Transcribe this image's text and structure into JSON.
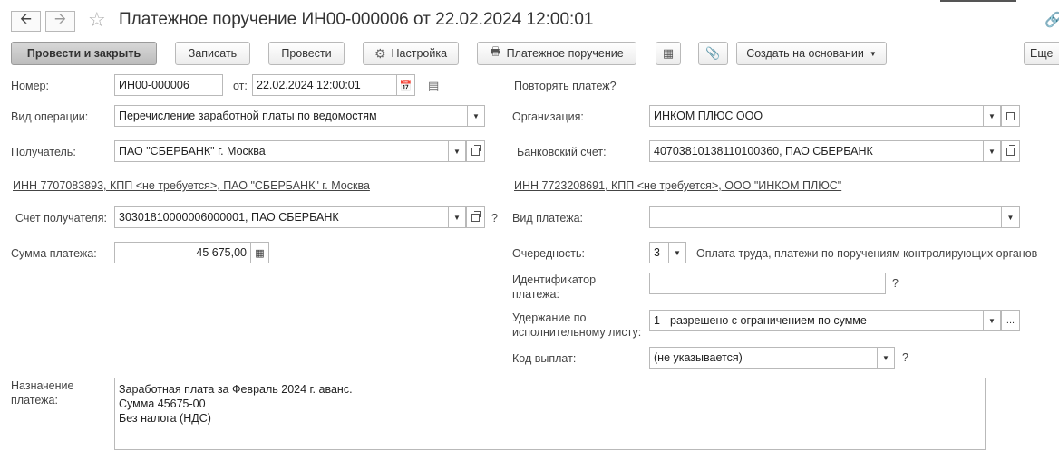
{
  "window": {
    "title": "Платежное поручение ИН00-000006 от 22.02.2024 12:00:01",
    "back_icon": "arrow-left-icon",
    "forward_icon": "arrow-right-icon",
    "favorite_icon": "star-icon"
  },
  "toolbar": {
    "post_and_close": "Провести и закрыть",
    "save": "Записать",
    "post": "Провести",
    "settings": "Настройка",
    "payment_order_print": "Платежное поручение",
    "create_based_on": "Создать на основании",
    "more": "Еще"
  },
  "form": {
    "number_label": "Номер:",
    "number_value": "ИН00-000006",
    "date_label": "от:",
    "date_value": "22.02.2024 12:00:01",
    "repeat_payment_link": "Повторять платеж?",
    "operation_type_label": "Вид операции:",
    "operation_type_value": "Перечисление заработной платы по ведомостям",
    "organization_label": "Организация:",
    "organization_value": "ИНКОМ ПЛЮС ООО",
    "recipient_label": "Получатель:",
    "recipient_value": "ПАО \"СБЕРБАНК\" г. Москва",
    "bank_account_label": "Банковский счет:",
    "bank_account_value": "40703810138110100360, ПАО СБЕРБАНК",
    "recipient_inn_link": "ИНН 7707083893, КПП <не требуется>, ПАО \"СБЕРБАНК\" г. Москва",
    "org_inn_link": "ИНН 7723208691, КПП <не требуется>, ООО \"ИНКОМ ПЛЮС\"",
    "recipient_account_label": "Счет получателя:",
    "recipient_account_value": "30301810000006000001, ПАО СБЕРБАНК",
    "payment_type_label": "Вид платежа:",
    "payment_type_value": "",
    "amount_label": "Сумма платежа:",
    "amount_value": "45 675,00",
    "priority_label": "Очередность:",
    "priority_value": "3",
    "priority_desc": "Оплата труда, платежи по поручениям контролирующих органов",
    "payment_id_label_1": "Идентификатор",
    "payment_id_label_2": "платежа:",
    "payment_id_value": "",
    "withholding_label_1": "Удержание по",
    "withholding_label_2": "исполнительному листу:",
    "withholding_value": "1 - разрешено с ограничением по сумме",
    "payout_code_label": "Код выплат:",
    "payout_code_value": "(не указывается)",
    "purpose_label_1": "Назначение",
    "purpose_label_2": "платежа:",
    "purpose_lines": [
      "Заработная плата за Февраль 2024 г. аванс.",
      "Сумма 45675-00",
      "Без налога (НДС)"
    ],
    "help_mark": "?",
    "ellipsis": "..."
  }
}
